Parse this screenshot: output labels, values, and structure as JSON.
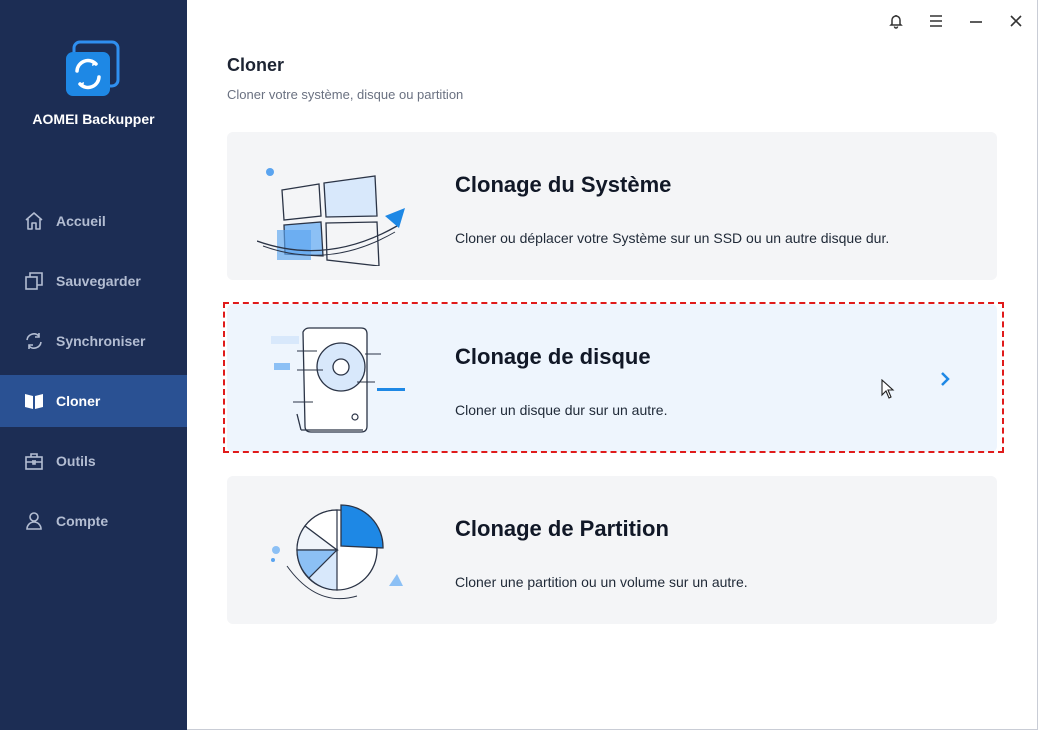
{
  "app": {
    "name": "AOMEI Backupper"
  },
  "sidebar": {
    "items": [
      {
        "label": "Accueil",
        "icon": "home-icon"
      },
      {
        "label": "Sauvegarder",
        "icon": "backup-icon"
      },
      {
        "label": "Synchroniser",
        "icon": "sync-icon"
      },
      {
        "label": "Cloner",
        "icon": "clone-icon",
        "active": true
      },
      {
        "label": "Outils",
        "icon": "toolbox-icon"
      },
      {
        "label": "Compte",
        "icon": "user-icon"
      }
    ]
  },
  "window_controls": [
    "bell-icon",
    "menu-icon",
    "minimize-icon",
    "close-icon"
  ],
  "page": {
    "title": "Cloner",
    "subtitle": "Cloner votre système, disque ou partition"
  },
  "cards": [
    {
      "title": "Clonage du Système",
      "desc": "Cloner ou déplacer votre Système sur un SSD ou un autre disque dur.",
      "icon": "windows-system-illustration"
    },
    {
      "title": "Clonage de disque",
      "desc": "Cloner un disque dur sur un autre.",
      "icon": "hard-disk-illustration",
      "selected": true
    },
    {
      "title": "Clonage de Partition",
      "desc": "Cloner une partition ou un volume sur un autre.",
      "icon": "pie-partition-illustration"
    }
  ],
  "colors": {
    "sidebar_bg": "#1c2d54",
    "active_item": "#2a5193",
    "accent": "#1e88e5",
    "card_bg": "#f4f5f7",
    "selected_card_bg": "#eef5fd",
    "highlight_border": "#e01b1b"
  }
}
